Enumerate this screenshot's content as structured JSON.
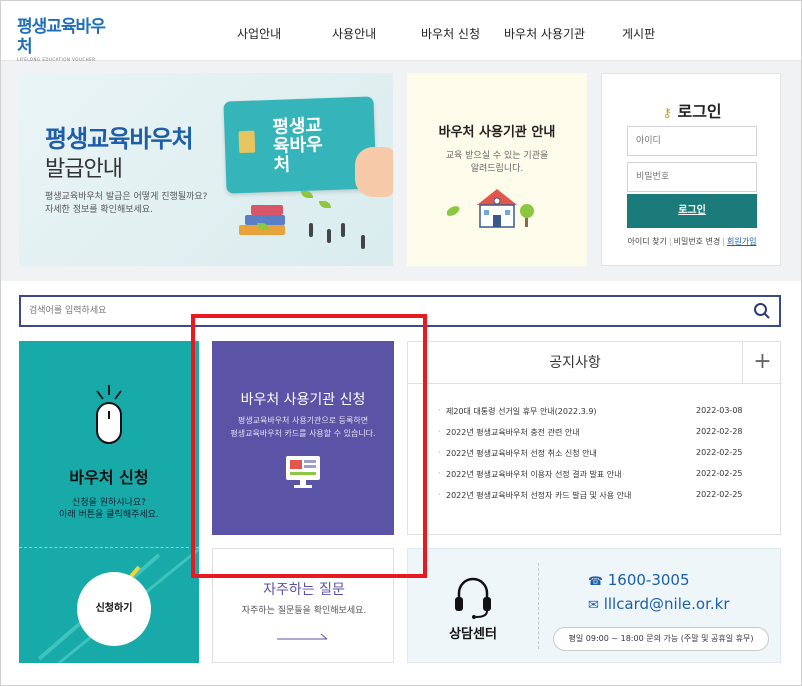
{
  "header": {
    "logo_text": "평생교육바우처",
    "logo_sub": "LIFELONG EDUCATION VOUCHER",
    "nav": [
      "사업안내",
      "사용안내",
      "바우처 신청",
      "바우처 사용기관",
      "게시판"
    ]
  },
  "banner": {
    "title": "평생교육바우처",
    "subtitle": "발급안내",
    "desc1": "평생교육바우처 발급은 어떻게 진행될까요?",
    "desc2": "자세한 정보를 확인해보세요.",
    "card_text": "평생교육바우처"
  },
  "org_panel": {
    "title": "바우처 사용기관 안내",
    "desc1": "교육 받으실 수 있는 기관을",
    "desc2": "알려드립니다."
  },
  "login": {
    "title": "로그인",
    "id_placeholder": "아이디",
    "pw_placeholder": "비밀번호",
    "button": "로그인",
    "find_id": "아이디 찾기",
    "change_pw": "비밀번호 변경",
    "join": "회원가입"
  },
  "search": {
    "placeholder": "검색어를 입력하세요"
  },
  "apply_box": {
    "title": "바우처 신청",
    "desc1": "신청을 원하시나요?",
    "desc2": "아래 버튼을 클릭해주세요.",
    "button": "신청하기"
  },
  "org_apply": {
    "title": "바우처 사용기관 신청",
    "desc1": "평생교육바우처 사용기관으로 등록하면",
    "desc2": "평생교육바우처 카드를 사용할 수 있습니다."
  },
  "faq": {
    "title": "자주하는 질문",
    "desc": "자주하는 질문들을 확인해보세요."
  },
  "notice": {
    "title": "공지사항",
    "more": "+",
    "items": [
      {
        "title": "제20대 대통령 선거일 휴무 안내(2022.3.9)",
        "date": "2022-03-08"
      },
      {
        "title": "2022년 평생교육바우처 충전 관련 안내",
        "date": "2022-02-28"
      },
      {
        "title": "2022년 평생교육바우처 선정 취소 신청 안내",
        "date": "2022-02-25"
      },
      {
        "title": "2022년 평생교육바우처 이용자 선정 결과 발표 안내",
        "date": "2022-02-25"
      },
      {
        "title": "2022년 평생교육바우처 선정자 카드 발급 및 사용 안내",
        "date": "2022-02-25"
      }
    ]
  },
  "contact": {
    "title": "상담센터",
    "phone": "1600-3005",
    "email": "lllcard@nile.or.kr",
    "hours": "평일 09:00 ~ 18:00 문의 가능 (주말 및 공휴일 휴무)"
  },
  "colors": {
    "brand_blue": "#1e5ea8",
    "teal": "#17aaa8",
    "purple": "#5b53a6",
    "login_button": "#1b7b7a",
    "highlight_red": "#e8191f"
  }
}
